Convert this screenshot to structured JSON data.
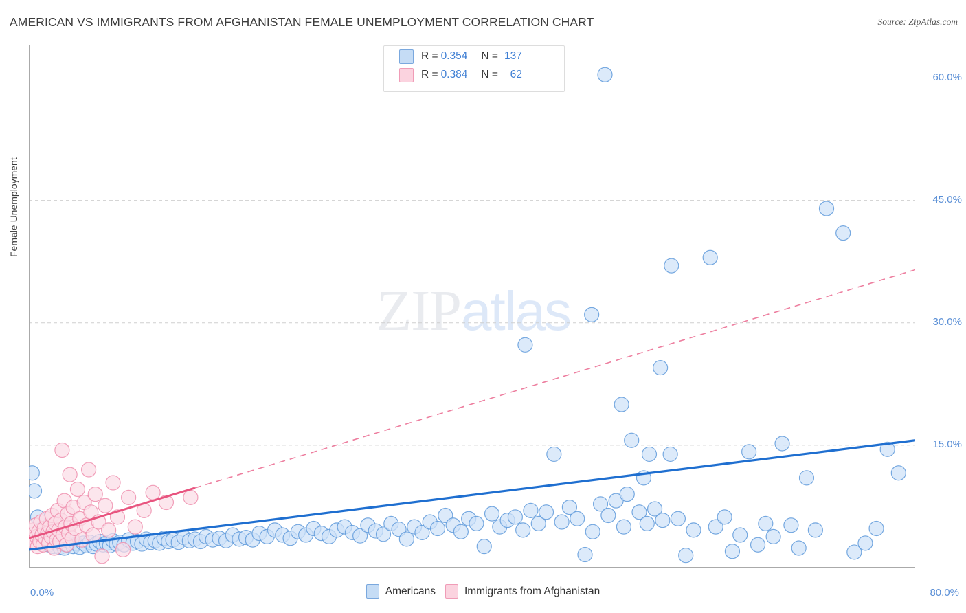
{
  "header": {
    "title": "AMERICAN VS IMMIGRANTS FROM AFGHANISTAN FEMALE UNEMPLOYMENT CORRELATION CHART",
    "source": "Source: ZipAtlas.com"
  },
  "watermark": {
    "part1": "ZIP",
    "part2": "atlas"
  },
  "stats_legend": {
    "rows": [
      {
        "r_label": "R =",
        "r_value": "0.354",
        "n_label": "N =",
        "n_value": "137",
        "color": "#c5dcf5"
      },
      {
        "r_label": "R =",
        "r_value": "0.384",
        "n_label": "N =",
        "n_value": "62",
        "color": "#fbd3df"
      }
    ]
  },
  "bottom_legend": {
    "items": [
      {
        "label": "Americans",
        "color": "#b9d5f5"
      },
      {
        "label": "Immigrants from Afghanistan",
        "color": "#fbd0de"
      }
    ]
  },
  "axes": {
    "y_title": "Female Unemployment",
    "y_ticks": [
      "60.0%",
      "45.0%",
      "30.0%",
      "15.0%"
    ],
    "x_min_label": "0.0%",
    "x_max_label": "80.0%"
  },
  "chart_data": {
    "type": "scatter",
    "title": "AMERICAN VS IMMIGRANTS FROM AFGHANISTAN FEMALE UNEMPLOYMENT CORRELATION CHART",
    "xlabel": "",
    "ylabel": "Female Unemployment",
    "xlim": [
      0,
      80
    ],
    "ylim": [
      0,
      64
    ],
    "x_unit": "%",
    "y_unit": "%",
    "grid": "horizontal-dashed",
    "y_gridlines": [
      15,
      30,
      45,
      60
    ],
    "x_ticks": [
      0,
      5,
      10,
      15,
      20,
      25,
      30,
      35,
      40,
      45,
      50,
      55,
      60,
      65,
      70,
      75,
      80
    ],
    "legend_position": "bottom-center",
    "series": [
      {
        "name": "Americans",
        "color": "#cfe2f8",
        "edge_color": "#5f9ada",
        "R": 0.354,
        "N": 137,
        "trendline": {
          "style": "solid",
          "color": "#1f6fd0",
          "x0": 0,
          "y0": 2.2,
          "x1": 80,
          "y1": 15.6
        },
        "points": [
          [
            0.3,
            11.6
          ],
          [
            0.5,
            9.4
          ],
          [
            0.8,
            6.2
          ],
          [
            1.0,
            4.6
          ],
          [
            1.2,
            3.4
          ],
          [
            1.5,
            3.0
          ],
          [
            1.8,
            2.8
          ],
          [
            2.0,
            3.2
          ],
          [
            2.2,
            2.6
          ],
          [
            2.5,
            3.0
          ],
          [
            2.8,
            2.5
          ],
          [
            3.0,
            2.9
          ],
          [
            3.2,
            2.4
          ],
          [
            3.5,
            2.8
          ],
          [
            3.8,
            3.1
          ],
          [
            4.0,
            2.6
          ],
          [
            4.3,
            2.9
          ],
          [
            4.6,
            2.5
          ],
          [
            4.9,
            3.0
          ],
          [
            5.2,
            2.7
          ],
          [
            5.5,
            3.1
          ],
          [
            5.8,
            2.6
          ],
          [
            6.1,
            2.9
          ],
          [
            6.4,
            3.2
          ],
          [
            6.7,
            2.8
          ],
          [
            7.0,
            3.0
          ],
          [
            7.3,
            2.7
          ],
          [
            7.6,
            3.3
          ],
          [
            7.9,
            2.9
          ],
          [
            8.2,
            3.1
          ],
          [
            8.6,
            2.8
          ],
          [
            9.0,
            3.4
          ],
          [
            9.4,
            3.0
          ],
          [
            9.8,
            3.2
          ],
          [
            10.2,
            2.9
          ],
          [
            10.6,
            3.5
          ],
          [
            11.0,
            3.1
          ],
          [
            11.4,
            3.3
          ],
          [
            11.8,
            3.0
          ],
          [
            12.2,
            3.6
          ],
          [
            12.6,
            3.2
          ],
          [
            13.0,
            3.4
          ],
          [
            13.5,
            3.1
          ],
          [
            14.0,
            3.7
          ],
          [
            14.5,
            3.3
          ],
          [
            15.0,
            3.5
          ],
          [
            15.5,
            3.2
          ],
          [
            16.0,
            3.8
          ],
          [
            16.6,
            3.4
          ],
          [
            17.2,
            3.6
          ],
          [
            17.8,
            3.3
          ],
          [
            18.4,
            4.0
          ],
          [
            19.0,
            3.5
          ],
          [
            19.6,
            3.7
          ],
          [
            20.2,
            3.4
          ],
          [
            20.8,
            4.2
          ],
          [
            21.5,
            3.8
          ],
          [
            22.2,
            4.6
          ],
          [
            22.9,
            4.0
          ],
          [
            23.6,
            3.6
          ],
          [
            24.3,
            4.4
          ],
          [
            25.0,
            4.0
          ],
          [
            25.7,
            4.8
          ],
          [
            26.4,
            4.2
          ],
          [
            27.1,
            3.8
          ],
          [
            27.8,
            4.6
          ],
          [
            28.5,
            5.0
          ],
          [
            29.2,
            4.3
          ],
          [
            29.9,
            3.9
          ],
          [
            30.6,
            5.2
          ],
          [
            31.3,
            4.5
          ],
          [
            32.0,
            4.1
          ],
          [
            32.7,
            5.4
          ],
          [
            33.4,
            4.7
          ],
          [
            34.1,
            3.5
          ],
          [
            34.8,
            5.0
          ],
          [
            35.5,
            4.3
          ],
          [
            36.2,
            5.6
          ],
          [
            36.9,
            4.8
          ],
          [
            37.6,
            6.4
          ],
          [
            38.3,
            5.2
          ],
          [
            39.0,
            4.4
          ],
          [
            39.7,
            6.0
          ],
          [
            40.4,
            5.4
          ],
          [
            41.1,
            2.6
          ],
          [
            41.8,
            6.6
          ],
          [
            42.5,
            5.0
          ],
          [
            43.2,
            5.8
          ],
          [
            43.9,
            6.2
          ],
          [
            44.6,
            4.6
          ],
          [
            45.3,
            7.0
          ],
          [
            46.0,
            5.4
          ],
          [
            46.7,
            6.8
          ],
          [
            47.4,
            13.9
          ],
          [
            48.1,
            5.6
          ],
          [
            48.8,
            7.4
          ],
          [
            49.5,
            6.0
          ],
          [
            50.2,
            1.6
          ],
          [
            50.9,
            4.4
          ],
          [
            51.6,
            7.8
          ],
          [
            52.0,
            60.4
          ],
          [
            52.3,
            6.4
          ],
          [
            53.0,
            8.2
          ],
          [
            53.7,
            5.0
          ],
          [
            44.8,
            27.3
          ],
          [
            54.4,
            15.6
          ],
          [
            55.1,
            6.8
          ],
          [
            55.8,
            5.4
          ],
          [
            56.5,
            7.2
          ],
          [
            57.2,
            5.8
          ],
          [
            57.9,
            13.9
          ],
          [
            58.6,
            6.0
          ],
          [
            59.3,
            1.5
          ],
          [
            60.0,
            4.6
          ],
          [
            50.8,
            31.0
          ],
          [
            53.5,
            20.0
          ],
          [
            54.0,
            9.0
          ],
          [
            56.0,
            13.9
          ],
          [
            57.0,
            24.5
          ],
          [
            58.0,
            37.0
          ],
          [
            61.5,
            38.0
          ],
          [
            62.0,
            5.0
          ],
          [
            62.8,
            6.2
          ],
          [
            63.5,
            2.0
          ],
          [
            64.2,
            4.0
          ],
          [
            55.5,
            11.0
          ],
          [
            65.0,
            14.2
          ],
          [
            65.8,
            2.8
          ],
          [
            66.5,
            5.4
          ],
          [
            67.2,
            3.8
          ],
          [
            68.0,
            15.2
          ],
          [
            68.8,
            5.2
          ],
          [
            69.5,
            2.4
          ],
          [
            70.2,
            11.0
          ],
          [
            71.0,
            4.6
          ],
          [
            72.0,
            44.0
          ],
          [
            73.5,
            41.0
          ],
          [
            74.5,
            1.9
          ],
          [
            75.5,
            3.0
          ],
          [
            76.5,
            4.8
          ],
          [
            77.5,
            14.5
          ],
          [
            78.5,
            11.6
          ]
        ]
      },
      {
        "name": "Immigrants from Afghanistan",
        "color": "#fbdce6",
        "edge_color": "#ef8fae",
        "R": 0.384,
        "N": 62,
        "trendline": {
          "style": "solid-then-dashed",
          "color": "#e8547f",
          "x0": 0,
          "y0": 3.6,
          "x1": 80,
          "y1": 36.5,
          "solid_until_x": 15
        },
        "points": [
          [
            0.2,
            4.0
          ],
          [
            0.3,
            3.4
          ],
          [
            0.4,
            4.6
          ],
          [
            0.5,
            3.0
          ],
          [
            0.6,
            5.2
          ],
          [
            0.7,
            3.8
          ],
          [
            0.8,
            2.6
          ],
          [
            0.9,
            4.4
          ],
          [
            1.0,
            3.2
          ],
          [
            1.1,
            5.6
          ],
          [
            1.2,
            4.0
          ],
          [
            1.3,
            2.8
          ],
          [
            1.4,
            4.8
          ],
          [
            1.5,
            3.6
          ],
          [
            1.6,
            6.0
          ],
          [
            1.7,
            4.2
          ],
          [
            1.8,
            3.0
          ],
          [
            1.9,
            5.0
          ],
          [
            2.0,
            3.8
          ],
          [
            2.1,
            6.4
          ],
          [
            2.2,
            4.4
          ],
          [
            2.3,
            2.4
          ],
          [
            2.4,
            5.4
          ],
          [
            2.5,
            3.4
          ],
          [
            2.6,
            7.0
          ],
          [
            2.7,
            4.6
          ],
          [
            2.8,
            3.2
          ],
          [
            2.9,
            5.8
          ],
          [
            3.0,
            14.4
          ],
          [
            3.1,
            4.0
          ],
          [
            3.2,
            8.2
          ],
          [
            3.3,
            5.0
          ],
          [
            3.4,
            2.8
          ],
          [
            3.5,
            6.6
          ],
          [
            3.6,
            4.2
          ],
          [
            3.7,
            11.4
          ],
          [
            3.8,
            5.4
          ],
          [
            3.9,
            3.6
          ],
          [
            4.0,
            7.4
          ],
          [
            4.2,
            4.8
          ],
          [
            4.4,
            9.6
          ],
          [
            4.6,
            6.0
          ],
          [
            4.8,
            3.4
          ],
          [
            5.0,
            8.0
          ],
          [
            5.2,
            5.2
          ],
          [
            5.4,
            12.0
          ],
          [
            5.6,
            6.8
          ],
          [
            5.8,
            4.0
          ],
          [
            6.0,
            9.0
          ],
          [
            6.3,
            5.6
          ],
          [
            6.6,
            1.4
          ],
          [
            6.9,
            7.6
          ],
          [
            7.2,
            4.6
          ],
          [
            7.6,
            10.4
          ],
          [
            8.0,
            6.2
          ],
          [
            8.5,
            2.2
          ],
          [
            9.0,
            8.6
          ],
          [
            9.6,
            5.0
          ],
          [
            10.4,
            7.0
          ],
          [
            11.2,
            9.2
          ],
          [
            12.4,
            8.0
          ],
          [
            14.6,
            8.6
          ]
        ]
      }
    ]
  }
}
